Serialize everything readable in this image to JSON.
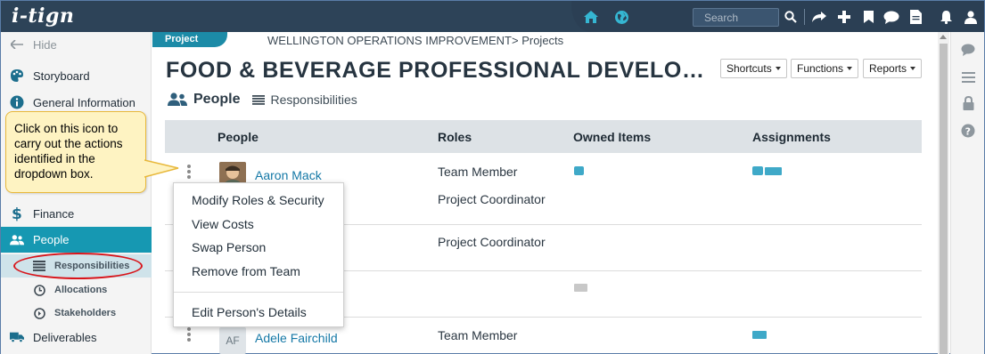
{
  "app": {
    "logo_text": "i-tign",
    "search_placeholder": "Search"
  },
  "topbar": {
    "icons": [
      "home-icon",
      "globe-icon",
      "search-icon",
      "share-icon",
      "plus-icon",
      "bookmark-icon",
      "chat-icon",
      "document-icon",
      "bell-icon",
      "user-icon"
    ]
  },
  "sidebar": {
    "hide_label": "Hide",
    "items": [
      {
        "label": "Storyboard",
        "icon": "palette-icon"
      },
      {
        "label": "General Information",
        "icon": "info-icon"
      },
      {
        "label": "Finance",
        "icon": "dollar-icon"
      },
      {
        "label": "People",
        "icon": "people-icon"
      },
      {
        "label": "Deliverables",
        "icon": "truck-icon"
      }
    ],
    "subitems": [
      {
        "label": "Responsibilities",
        "icon": "list-icon"
      },
      {
        "label": "Allocations",
        "icon": "clock-icon"
      },
      {
        "label": "Stakeholders",
        "icon": "arrow-circle-icon"
      }
    ]
  },
  "callout": {
    "text": "Click on this icon to carry out the actions identified in the dropdown box."
  },
  "header": {
    "project_tab": "Project",
    "breadcrumb": "WELLINGTON OPERATIONS IMPROVEMENT> Projects",
    "title": "FOOD & BEVERAGE PROFESSIONAL DEVELO…",
    "buttons": {
      "shortcuts": "Shortcuts",
      "functions": "Functions",
      "reports": "Reports"
    }
  },
  "section_tabs": {
    "people": "People",
    "responsibilities": "Responsibilities"
  },
  "table": {
    "columns": [
      "People",
      "Roles",
      "Owned Items",
      "Assignments"
    ],
    "rows": [
      {
        "name": "Aaron Mack",
        "roles": [
          "Team Member",
          "Project Coordinator"
        ]
      },
      {
        "name": "",
        "roles": [
          "Project Coordinator"
        ]
      },
      {
        "name": "",
        "roles": []
      },
      {
        "name": "Adele Fairchild",
        "initials": "AF",
        "roles": [
          "Team Member"
        ]
      }
    ]
  },
  "dropdown": {
    "items": [
      "Modify Roles & Security",
      "View Costs",
      "Swap Person",
      "Remove from Team"
    ],
    "footer_item": "Edit Person's Details"
  },
  "colors": {
    "accent": "#1698b2",
    "topbar": "#2d4358",
    "bar_blue": "#3fa9c8",
    "bar_grey": "#c8c8c8",
    "callout_bg": "#fef3c2",
    "callout_border": "#e8b83a",
    "highlight_ring": "#d8151b"
  },
  "right_rail": {
    "icons": [
      "comment-icon",
      "list-lines-icon",
      "lock-icon",
      "help-icon"
    ]
  }
}
